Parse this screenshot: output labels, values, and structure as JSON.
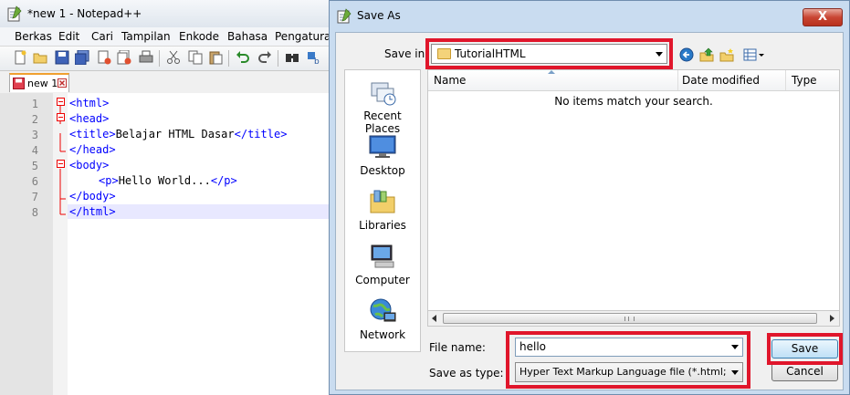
{
  "notepad": {
    "title": "*new 1 - Notepad++",
    "menu": [
      "Berkas",
      "Edit",
      "Cari",
      "Tampilan",
      "Enkode",
      "Bahasa",
      "Pengaturan"
    ],
    "tab_label": "new 1",
    "line_numbers": [
      "1",
      "2",
      "3",
      "4",
      "5",
      "6",
      "7",
      "8"
    ],
    "code": {
      "l1": "<html>",
      "l2": "<head>",
      "l3_open": "<title>",
      "l3_text": "Belajar HTML Dasar",
      "l3_close": "</title>",
      "l4": "</head>",
      "l5": "<body>",
      "l6_open": "<p>",
      "l6_text": "Hello World...",
      "l6_close": "</p>",
      "l7": "</body>",
      "l8": "</html>"
    }
  },
  "dialog": {
    "title": "Save As",
    "close_glyph": "X",
    "save_in_label": "Save in:",
    "save_in_value": "TutorialHTML",
    "places": [
      "Recent Places",
      "Desktop",
      "Libraries",
      "Computer",
      "Network"
    ],
    "columns": [
      "Name",
      "Date modified",
      "Type"
    ],
    "empty_message": "No items match your search.",
    "file_name_label": "File name:",
    "file_name_value": "hello",
    "save_as_type_label": "Save as type:",
    "save_as_type_value": "Hyper Text Markup Language file (*.html;*.htm;*",
    "save_button": "Save",
    "cancel_button": "Cancel"
  },
  "colors": {
    "highlight": "#e0162b",
    "tag_blue": "#0000ff",
    "dialog_frame": "#c9dcf0"
  }
}
